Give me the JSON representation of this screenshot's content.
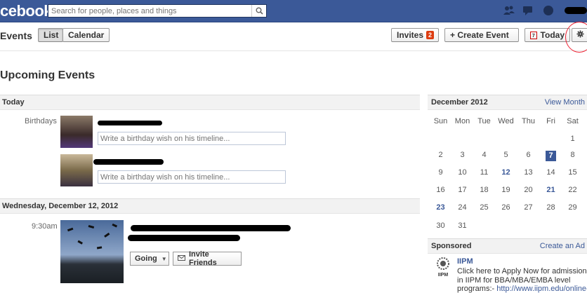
{
  "topbar": {
    "logo": "cebook",
    "search_placeholder": "Search for people, places and things"
  },
  "header": {
    "title": "Events",
    "list_label": "List",
    "calendar_label": "Calendar",
    "invites_label": "Invites",
    "invites_count": "2",
    "create_label": "+ Create Event",
    "today_label": "Today",
    "today_icon_num": "7"
  },
  "main": {
    "upcoming_title": "Upcoming Events",
    "today_section": "Today",
    "birthdays_label": "Birthdays",
    "wish_placeholder": "Write a birthday wish on his timeline...",
    "wed_section": "Wednesday, December 12, 2012",
    "event_time": "9:30am",
    "going_label": "Going",
    "invite_label": "Invite Friends"
  },
  "sidebar": {
    "month_title": "December 2012",
    "view_month": "View Month",
    "weekdays": [
      "Sun",
      "Mon",
      "Tue",
      "Wed",
      "Thu",
      "Fri",
      "Sat"
    ],
    "weeks": [
      [
        "",
        "",
        "",
        "",
        "",
        "",
        "1"
      ],
      [
        "2",
        "3",
        "4",
        "5",
        "6",
        "7",
        "8"
      ],
      [
        "9",
        "10",
        "11",
        "12",
        "13",
        "14",
        "15"
      ],
      [
        "16",
        "17",
        "18",
        "19",
        "20",
        "21",
        "22"
      ],
      [
        "23",
        "24",
        "25",
        "26",
        "27",
        "28",
        "29"
      ],
      [
        "30",
        "31",
        "",
        "",
        "",
        "",
        ""
      ]
    ],
    "today_day": "7",
    "event_days": [
      "12",
      "21",
      "23"
    ],
    "sponsored_title": "Sponsored",
    "create_ad": "Create an Ad",
    "ad_title": "IIPM",
    "ad_text_1": "Click here to Apply Now for admissions",
    "ad_text_2": "in IIPM for BBA/MBA/EMBA level",
    "ad_text_3": "programs:- ",
    "ad_link": "http://www.iipm.edu/online-",
    "ad_logo_text": "IIPM"
  },
  "colors": {
    "brand": "#3b5998",
    "badge": "#dd3c10",
    "highlight_circle": "#e23"
  }
}
